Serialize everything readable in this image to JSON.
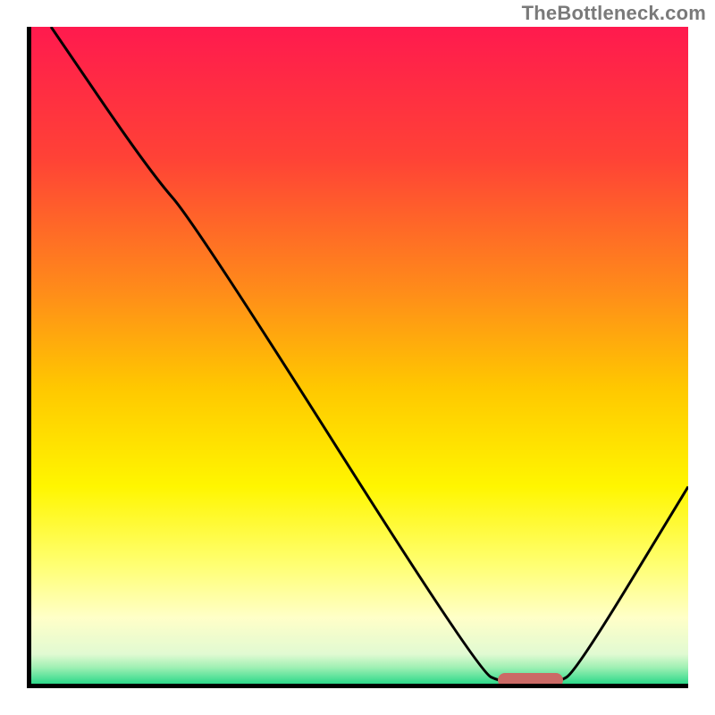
{
  "watermark": "TheBottleneck.com",
  "chart_data": {
    "type": "line",
    "title": "",
    "xlabel": "",
    "ylabel": "",
    "xlim": [
      0,
      100
    ],
    "ylim": [
      0,
      100
    ],
    "grid": false,
    "legend": false,
    "gradient_stops": [
      {
        "pos": 0.0,
        "color": "#ff1a4e"
      },
      {
        "pos": 0.2,
        "color": "#ff4236"
      },
      {
        "pos": 0.4,
        "color": "#ff8b1a"
      },
      {
        "pos": 0.55,
        "color": "#ffc800"
      },
      {
        "pos": 0.7,
        "color": "#fff600"
      },
      {
        "pos": 0.82,
        "color": "#ffff73"
      },
      {
        "pos": 0.9,
        "color": "#ffffc8"
      },
      {
        "pos": 0.955,
        "color": "#e1fad2"
      },
      {
        "pos": 0.975,
        "color": "#a0f0b4"
      },
      {
        "pos": 1.0,
        "color": "#2dd98a"
      }
    ],
    "series": [
      {
        "name": "bottleneck-curve",
        "points": [
          {
            "x": 3,
            "y": 100
          },
          {
            "x": 18,
            "y": 78
          },
          {
            "x": 25,
            "y": 70
          },
          {
            "x": 68,
            "y": 2
          },
          {
            "x": 72,
            "y": 0
          },
          {
            "x": 80,
            "y": 0
          },
          {
            "x": 83,
            "y": 2
          },
          {
            "x": 100,
            "y": 30
          }
        ]
      }
    ],
    "optimal_marker": {
      "x_start": 71,
      "x_end": 81,
      "y": 0,
      "color": "#cb6a66"
    }
  }
}
